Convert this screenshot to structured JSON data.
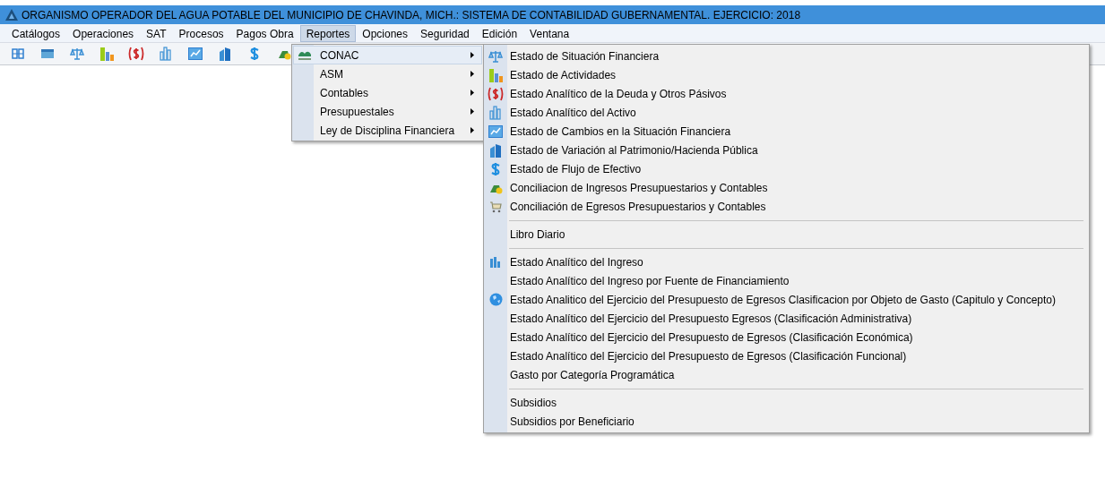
{
  "window": {
    "title": "ORGANISMO OPERADOR DEL AGUA POTABLE DEL MUNICIPIO DE CHAVINDA, MICH.: SISTEMA DE CONTABILIDAD GUBERNAMENTAL. EJERCICIO: 2018"
  },
  "menu_bar": [
    {
      "label": "Catálogos",
      "selected": false
    },
    {
      "label": "Operaciones",
      "selected": false
    },
    {
      "label": "SAT",
      "selected": false
    },
    {
      "label": "Procesos",
      "selected": false
    },
    {
      "label": "Pagos Obra",
      "selected": false
    },
    {
      "label": "Reportes",
      "selected": true
    },
    {
      "label": "Opciones",
      "selected": false
    },
    {
      "label": "Seguridad",
      "selected": false
    },
    {
      "label": "Edición",
      "selected": false
    },
    {
      "label": "Ventana",
      "selected": false
    }
  ],
  "reportes_menu": {
    "items": [
      {
        "label": "CONAC",
        "selected": true,
        "has_submenu": true
      },
      {
        "label": "ASM",
        "selected": false,
        "has_submenu": true
      },
      {
        "label": "Contables",
        "selected": false,
        "has_submenu": true
      },
      {
        "label": "Presupuestales",
        "selected": false,
        "has_submenu": true
      },
      {
        "label": "Ley de Disciplina Financiera",
        "selected": false,
        "has_submenu": true
      }
    ]
  },
  "conac_submenu": {
    "items": [
      {
        "kind": "item",
        "label": "Estado de Situación Financiera"
      },
      {
        "kind": "item",
        "label": "Estado de Actividades"
      },
      {
        "kind": "item",
        "label": "Estado Analítico de la Deuda y Otros Pásivos"
      },
      {
        "kind": "item",
        "label": "Estado Analítico del Activo"
      },
      {
        "kind": "item",
        "label": "Estado de Cambios en la Situación Financiera"
      },
      {
        "kind": "item",
        "label": "Estado de Variación al Patrimonio/Hacienda Pública"
      },
      {
        "kind": "item",
        "label": "Estado de Flujo de Efectivo"
      },
      {
        "kind": "item",
        "label": "Conciliacion de Ingresos Presupuestarios y Contables"
      },
      {
        "kind": "item",
        "label": "Conciliación de Egresos Presupuestarios y Contables"
      },
      {
        "kind": "separator"
      },
      {
        "kind": "item",
        "label": "Libro Diario"
      },
      {
        "kind": "separator"
      },
      {
        "kind": "item",
        "label": "Estado Analítico del Ingreso"
      },
      {
        "kind": "item",
        "label": "Estado Analítico del Ingreso por Fuente de Financiamiento"
      },
      {
        "kind": "item",
        "label": "Estado Analitico del Ejercicio del Presupuesto de Egresos Clasificacion por Objeto de Gasto (Capitulo y Concepto)"
      },
      {
        "kind": "item",
        "label": "Estado Analítico del Ejercicio del Presupuesto Egresos (Clasificación Administrativa)"
      },
      {
        "kind": "item",
        "label": "Estado Analítico del Ejercicio del Presupuesto de Egresos (Clasificación Económica)"
      },
      {
        "kind": "item",
        "label": "Estado Analítico del Ejercicio del Presupuesto de Egresos (Clasificación Funcional)"
      },
      {
        "kind": "item",
        "label": "Gasto por Categoría Programática"
      },
      {
        "kind": "separator"
      },
      {
        "kind": "item",
        "label": "Subsidios"
      },
      {
        "kind": "item",
        "label": "Subsidios por Beneficiario"
      }
    ]
  }
}
